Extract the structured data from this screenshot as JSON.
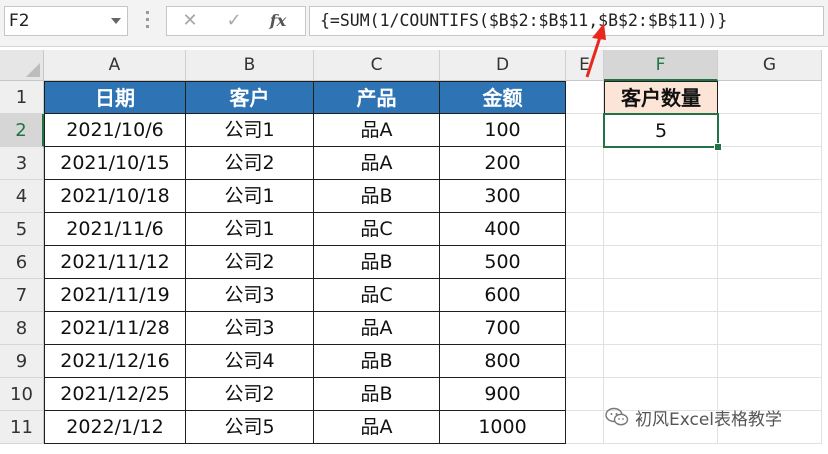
{
  "formula_bar": {
    "name_box": "F2",
    "cancel_icon": "✕",
    "enter_icon": "✓",
    "fx_label": "fx",
    "formula": "{=SUM(1/COUNTIFS($B$2:$B$11,$B$2:$B$11))}"
  },
  "columns": [
    "A",
    "B",
    "C",
    "D",
    "E",
    "F",
    "G"
  ],
  "rows": [
    "1",
    "2",
    "3",
    "4",
    "5",
    "6",
    "7",
    "8",
    "9",
    "10",
    "11"
  ],
  "table": {
    "headers": [
      "日期",
      "客户",
      "产品",
      "金额"
    ],
    "records": [
      [
        "2021/10/6",
        "公司1",
        "品A",
        "100"
      ],
      [
        "2021/10/15",
        "公司2",
        "品A",
        "200"
      ],
      [
        "2021/10/18",
        "公司1",
        "品B",
        "300"
      ],
      [
        "2021/11/6",
        "公司1",
        "品C",
        "400"
      ],
      [
        "2021/11/12",
        "公司2",
        "品B",
        "500"
      ],
      [
        "2021/11/19",
        "公司3",
        "品C",
        "600"
      ],
      [
        "2021/11/28",
        "公司3",
        "品A",
        "700"
      ],
      [
        "2021/12/16",
        "公司4",
        "品B",
        "800"
      ],
      [
        "2021/12/25",
        "公司2",
        "品B",
        "900"
      ],
      [
        "2022/1/12",
        "公司5",
        "品A",
        "1000"
      ]
    ]
  },
  "summary": {
    "header": "客户数量",
    "value": "5"
  },
  "watermark": {
    "text": "初风Excel表格教学",
    "icon": "wechat-icon"
  },
  "colors": {
    "table_header_bg": "#2e74b5",
    "summary_header_bg": "#fce4d6",
    "selection_green": "#217346",
    "arrow_red": "#e8281c"
  }
}
